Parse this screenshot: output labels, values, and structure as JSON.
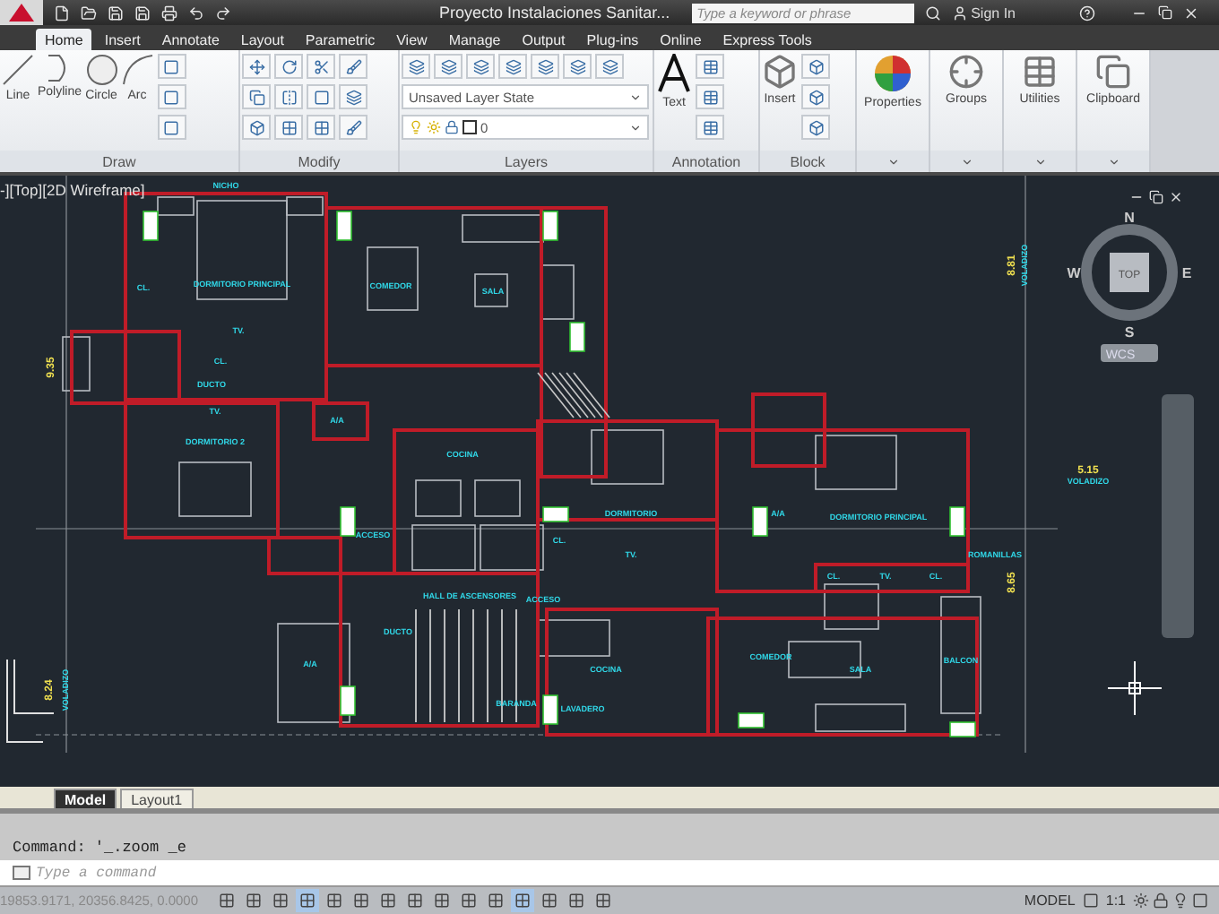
{
  "title_bar": {
    "title": "Proyecto Instalaciones Sanitar...",
    "search": {
      "placeholder": "Type a keyword or phrase"
    },
    "sign_in": "Sign In"
  },
  "ribbon_tabs": [
    {
      "label": "Home",
      "selected": true
    },
    {
      "label": "Insert",
      "selected": false
    },
    {
      "label": "Annotate",
      "selected": false
    },
    {
      "label": "Layout",
      "selected": false
    },
    {
      "label": "Parametric",
      "selected": false
    },
    {
      "label": "View",
      "selected": false
    },
    {
      "label": "Manage",
      "selected": false
    },
    {
      "label": "Output",
      "selected": false
    },
    {
      "label": "Plug-ins",
      "selected": false
    },
    {
      "label": "Online",
      "selected": false
    },
    {
      "label": "Express Tools",
      "selected": false
    }
  ],
  "ribbon": {
    "draw": {
      "label": "Draw",
      "tools": [
        "Line",
        "Polyline",
        "Circle",
        "Arc"
      ]
    },
    "modify": {
      "label": "Modify"
    },
    "layers": {
      "label": "Layers",
      "layer_state": "Unsaved Layer State",
      "current_layer": "0"
    },
    "annotation": {
      "label": "Annotation",
      "tool": "Text"
    },
    "block": {
      "label": "Block",
      "tool": "Insert"
    },
    "big_tools": [
      "Properties",
      "Groups",
      "Utilities",
      "Clipboard"
    ]
  },
  "viewport": {
    "label": "-][Top][2D Wireframe]",
    "viewcube": {
      "north": "N",
      "east": "E",
      "south": "S",
      "west": "W",
      "face": "TOP",
      "ucs": "WCS"
    },
    "plan_labels": [
      {
        "text": "NICHO",
        "kind": "room"
      },
      {
        "text": "8.81",
        "kind": "dimension"
      },
      {
        "text": "VOLADIZO",
        "kind": "room"
      },
      {
        "text": "CL.",
        "kind": "room"
      },
      {
        "text": "DORMITORIO PRINCIPAL",
        "kind": "room"
      },
      {
        "text": "COMEDOR",
        "kind": "room"
      },
      {
        "text": "SALA",
        "kind": "room"
      },
      {
        "text": "TV.",
        "kind": "room"
      },
      {
        "text": "9.35",
        "kind": "dimension"
      },
      {
        "text": "CL.",
        "kind": "room"
      },
      {
        "text": "DUCTO",
        "kind": "room"
      },
      {
        "text": "TV.",
        "kind": "room"
      },
      {
        "text": "A/A",
        "kind": "room"
      },
      {
        "text": "DORMITORIO 2",
        "kind": "room"
      },
      {
        "text": "COCINA",
        "kind": "room"
      },
      {
        "text": "5.15",
        "kind": "dimension"
      },
      {
        "text": "VOLADIZO",
        "kind": "room"
      },
      {
        "text": "DORMITORIO",
        "kind": "room"
      },
      {
        "text": "A/A",
        "kind": "room"
      },
      {
        "text": "DORMITORIO PRINCIPAL",
        "kind": "room"
      },
      {
        "text": "ACCESO",
        "kind": "room"
      },
      {
        "text": "CL.",
        "kind": "room"
      },
      {
        "text": "ROMANILLAS",
        "kind": "room"
      },
      {
        "text": "TV.",
        "kind": "room"
      },
      {
        "text": "CL.",
        "kind": "room"
      },
      {
        "text": "TV.",
        "kind": "room"
      },
      {
        "text": "CL.",
        "kind": "room"
      },
      {
        "text": "8.65",
        "kind": "dimension"
      },
      {
        "text": "HALL DE ASCENSORES",
        "kind": "room"
      },
      {
        "text": "ACCESO",
        "kind": "room"
      },
      {
        "text": "DUCTO",
        "kind": "room"
      },
      {
        "text": "A/A",
        "kind": "room"
      },
      {
        "text": "COCINA",
        "kind": "room"
      },
      {
        "text": "COMEDOR",
        "kind": "room"
      },
      {
        "text": "SALA",
        "kind": "room"
      },
      {
        "text": "BALCON",
        "kind": "room"
      },
      {
        "text": "8.24",
        "kind": "dimension"
      },
      {
        "text": "VOLADIZO",
        "kind": "room"
      },
      {
        "text": "BARANDA",
        "kind": "room"
      },
      {
        "text": "LAVADERO",
        "kind": "room"
      }
    ]
  },
  "layout_tabs": [
    {
      "label": "Model",
      "selected": true
    },
    {
      "label": "Layout1",
      "selected": false
    }
  ],
  "command_line": {
    "history": "Command: '_.zoom _e",
    "placeholder": "Type a command"
  },
  "status_bar": {
    "coordinates": "19853.9171, 20356.8425, 0.0000",
    "space": "MODEL",
    "scale": "1:1",
    "toggles": [
      {
        "on": false
      },
      {
        "on": false
      },
      {
        "on": false
      },
      {
        "on": true
      },
      {
        "on": false
      },
      {
        "on": false
      },
      {
        "on": false
      },
      {
        "on": false
      },
      {
        "on": false
      },
      {
        "on": false
      },
      {
        "on": false
      },
      {
        "on": true
      },
      {
        "on": false
      },
      {
        "on": false
      },
      {
        "on": false
      }
    ]
  }
}
